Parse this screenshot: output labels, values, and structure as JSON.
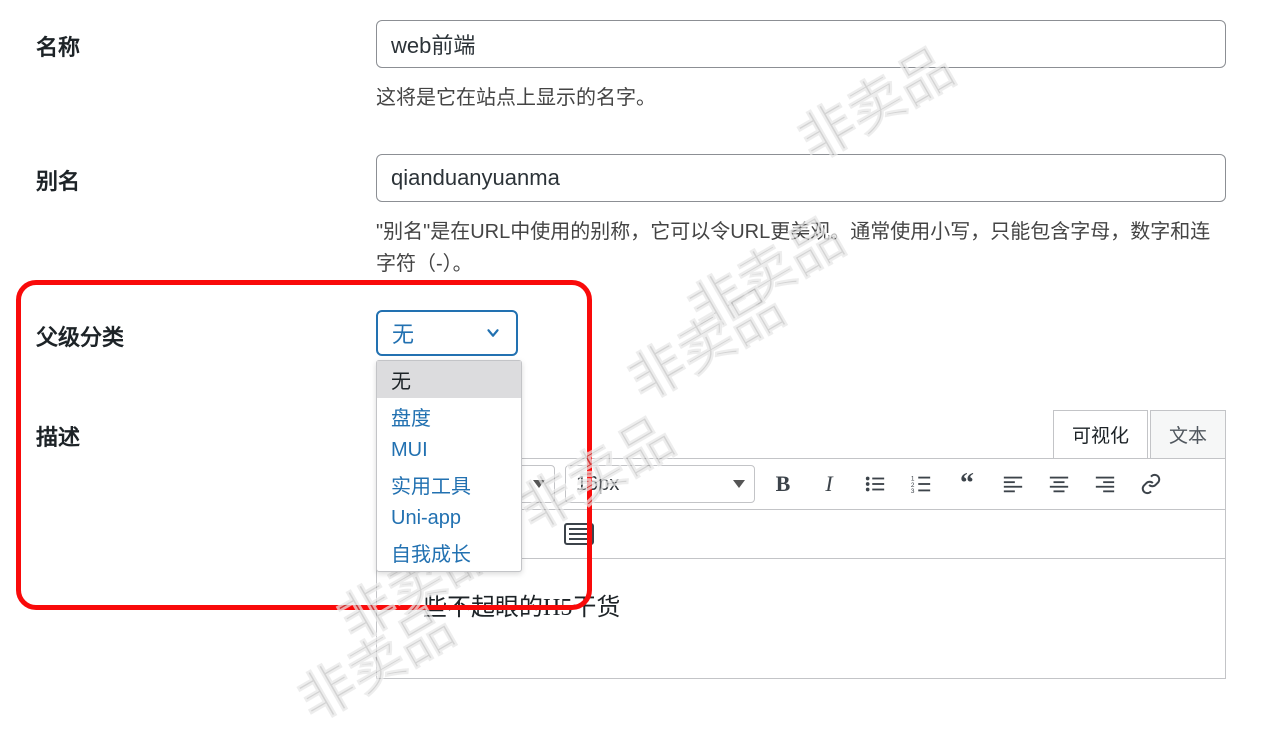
{
  "form": {
    "name": {
      "label": "名称",
      "value": "web前端",
      "help": "这将是它在站点上显示的名字。"
    },
    "slug": {
      "label": "别名",
      "value": "qianduanyuanma",
      "help": "\"别名\"是在URL中使用的别称，它可以令URL更美观。通常使用小写，只能包含字母，数字和连字符（-）。"
    },
    "parent": {
      "label": "父级分类",
      "selected": "无",
      "options": [
        "无",
        "盘度",
        "MUI",
        "实用工具",
        "Uni-app",
        "自我成长"
      ]
    },
    "desc": {
      "label": "描述",
      "tabs": {
        "visual": "可视化",
        "text": "文本"
      },
      "fontSize": "16px",
      "content": "一些不起眼的H5干货"
    }
  },
  "watermark": "非卖品"
}
